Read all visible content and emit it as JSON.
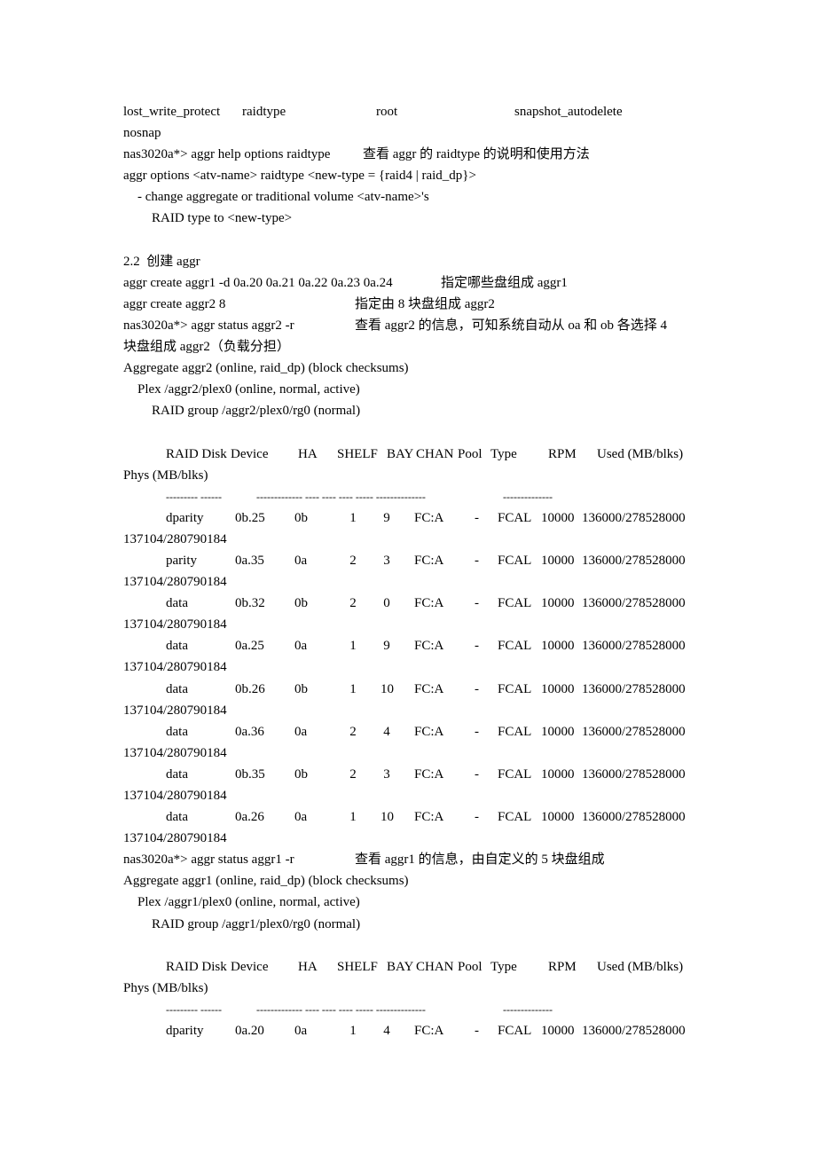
{
  "lines": {
    "options_list": [
      "lost_write_protect",
      "raidtype",
      "root",
      "snapshot_autodelete"
    ],
    "nosnap": "nosnap",
    "help_cmd": "nas3020a*> aggr help options raidtype",
    "help_note": "查看 aggr 的 raidtype 的说明和使用方法",
    "usage": "aggr options <atv-name> raidtype <new-type = {raid4 | raid_dp}>",
    "usage_desc1": "- change aggregate or traditional volume <atv-name>'s",
    "usage_desc2": "RAID type to <new-type>",
    "section_title": "2.2  创建 aggr",
    "create1_cmd": "aggr create aggr1 -d 0a.20 0a.21 0a.22 0a.23 0a.24",
    "create1_note": "指定哪些盘组成 aggr1",
    "create2_cmd": "aggr create aggr2 8",
    "create2_note": "指定由 8 块盘组成 aggr2",
    "status2_cmd": "nas3020a*> aggr status aggr2 -r",
    "status2_note": "查看 aggr2 的信息，可知系统自动从 oa 和 ob 各选择 4",
    "status2_note_cont": "块盘组成 aggr2（负载分担）",
    "aggr2_header": "Aggregate aggr2 (online, raid_dp) (block checksums)",
    "aggr2_plex": "Plex /aggr2/plex0 (online, normal, active)",
    "aggr2_rg": "RAID group /aggr2/plex0/rg0 (normal)",
    "status1_cmd": "nas3020a*> aggr status aggr1 -r",
    "status1_note": "查看 aggr1 的信息，由自定义的 5 块盘组成",
    "aggr1_header": "Aggregate aggr1 (online, raid_dp) (block checksums)",
    "aggr1_plex": "Plex /aggr1/plex0 (online, normal, active)",
    "aggr1_rg": "RAID group /aggr1/plex0/rg0 (normal)"
  },
  "table_header": {
    "main": "RAID Disk Device     HA     SHELF  BAY  CHAN  Pool  Type     RPM     Used (MB/blks)",
    "cont": "Phys (MB/blks)",
    "dashes_a": "--------- ------",
    "dashes_b": "------------- ---- ---- ---- ----- --------------",
    "dashes_c": "--------------"
  },
  "aggr2_disks": [
    {
      "raid": "dparity",
      "device": "0b.25",
      "ha": "0b",
      "shelf": "1",
      "bay": "9",
      "chan": "FC:A",
      "pool": "-",
      "type": "FCAL",
      "rpm": "10000",
      "used": "136000/278528000",
      "phys": "137104/280790184"
    },
    {
      "raid": "parity",
      "device": "0a.35",
      "ha": "0a",
      "shelf": "2",
      "bay": "3",
      "chan": "FC:A",
      "pool": "-",
      "type": "FCAL",
      "rpm": "10000",
      "used": "136000/278528000",
      "phys": "137104/280790184"
    },
    {
      "raid": "data",
      "device": "0b.32",
      "ha": "0b",
      "shelf": "2",
      "bay": "0",
      "chan": "FC:A",
      "pool": "-",
      "type": "FCAL",
      "rpm": "10000",
      "used": "136000/278528000",
      "phys": "137104/280790184"
    },
    {
      "raid": "data",
      "device": "0a.25",
      "ha": "0a",
      "shelf": "1",
      "bay": "9",
      "chan": "FC:A",
      "pool": "-",
      "type": "FCAL",
      "rpm": "10000",
      "used": "136000/278528000",
      "phys": "137104/280790184"
    },
    {
      "raid": "data",
      "device": "0b.26",
      "ha": "0b",
      "shelf": "1",
      "bay": "10",
      "chan": "FC:A",
      "pool": "-",
      "type": "FCAL",
      "rpm": "10000",
      "used": "136000/278528000",
      "phys": "137104/280790184"
    },
    {
      "raid": "data",
      "device": "0a.36",
      "ha": "0a",
      "shelf": "2",
      "bay": "4",
      "chan": "FC:A",
      "pool": "-",
      "type": "FCAL",
      "rpm": "10000",
      "used": "136000/278528000",
      "phys": "137104/280790184"
    },
    {
      "raid": "data",
      "device": "0b.35",
      "ha": "0b",
      "shelf": "2",
      "bay": "3",
      "chan": "FC:A",
      "pool": "-",
      "type": "FCAL",
      "rpm": "10000",
      "used": "136000/278528000",
      "phys": "137104/280790184"
    },
    {
      "raid": "data",
      "device": "0a.26",
      "ha": "0a",
      "shelf": "1",
      "bay": "10",
      "chan": "FC:A",
      "pool": "-",
      "type": "FCAL",
      "rpm": "10000",
      "used": "136000/278528000",
      "phys": "137104/280790184"
    }
  ],
  "aggr1_disks": [
    {
      "raid": "dparity",
      "device": "0a.20",
      "ha": "0a",
      "shelf": "1",
      "bay": "4",
      "chan": "FC:A",
      "pool": "-",
      "type": "FCAL",
      "rpm": "10000",
      "used": "136000/278528000"
    }
  ]
}
